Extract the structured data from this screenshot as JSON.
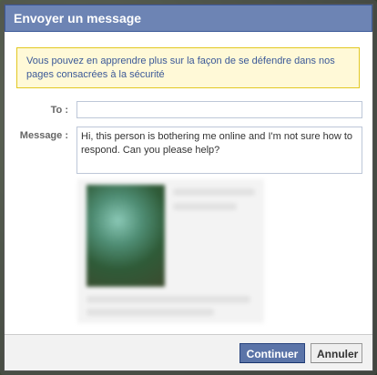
{
  "dialog": {
    "title": "Envoyer un message",
    "notice": "Vous pouvez en apprendre plus sur la façon de se défendre dans nos pages consacrées à la sécurité",
    "to_label": "To :",
    "to_value": "",
    "message_label": "Message :",
    "message_value": "Hi, this person is bothering me online and I'm not sure how to respond. Can you please help?",
    "buttons": {
      "continue": "Continuer",
      "cancel": "Annuler"
    }
  },
  "colors": {
    "titlebar": "#6d84b4",
    "notice_bg": "#fff9d7",
    "notice_border": "#e2c822",
    "primary_button": "#5b74a8"
  }
}
